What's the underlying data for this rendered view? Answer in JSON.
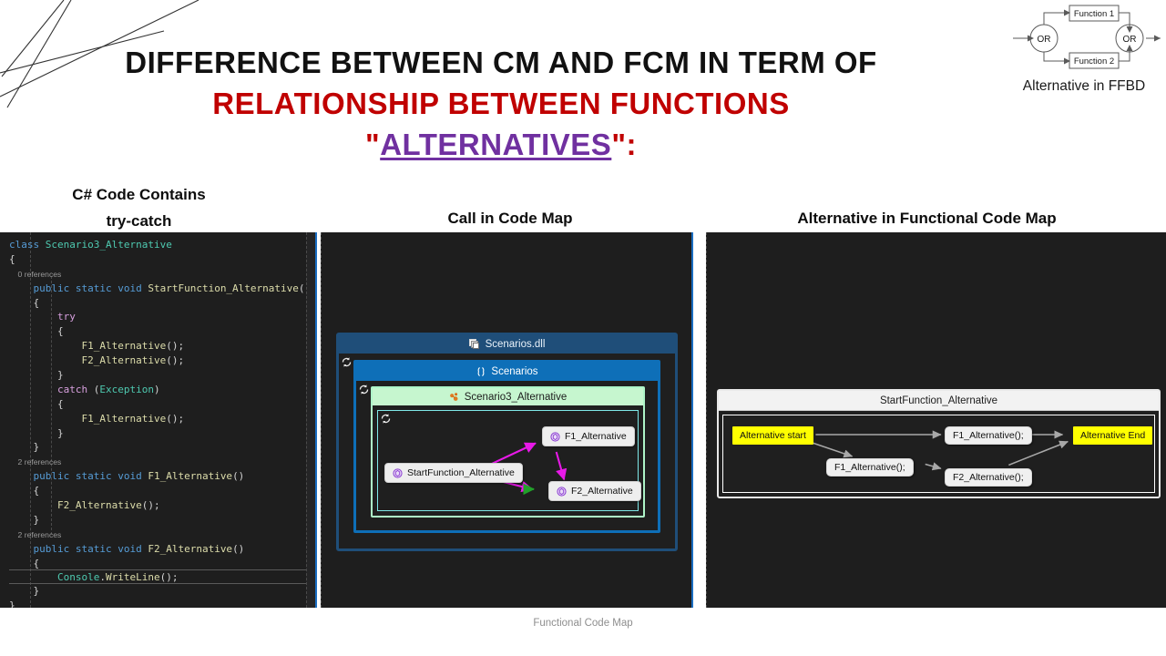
{
  "title": {
    "line1": "DIFFERENCE BETWEEN CM AND FCM IN TERM OF",
    "line2": "RELATIONSHIP BETWEEN FUNCTIONS",
    "line3_quote_open": "\"",
    "line3_alt": "ALTERNATIVES",
    "line3_quote_close": "\":",
    "color_line1": "#111111",
    "color_line2": "#C00000",
    "color_alt": "#7030A0"
  },
  "ffbd": {
    "caption": "Alternative in FFBD",
    "or_left": "OR",
    "or_right": "OR",
    "function1": "Function 1",
    "function2": "Function 2"
  },
  "columns": {
    "left_line1": "C# Code Contains",
    "left_line2": "try-catch",
    "middle": "Call in Code Map",
    "right": "Alternative in Functional Code Map"
  },
  "editor": {
    "lines": [
      {
        "id": "l1",
        "segments": [
          {
            "t": "class ",
            "c": "kw"
          },
          {
            "t": "Scenario3_Alternative",
            "c": "type"
          }
        ]
      },
      {
        "id": "l2",
        "segments": [
          {
            "t": "{",
            "c": "pun"
          }
        ]
      },
      {
        "id": "l3",
        "ref": "0 references",
        "indent": 2
      },
      {
        "id": "l4",
        "indent": 2,
        "segments": [
          {
            "t": "public ",
            "c": "kw"
          },
          {
            "t": "static ",
            "c": "kw"
          },
          {
            "t": "void ",
            "c": "kw"
          },
          {
            "t": "StartFunction_Alternative",
            "c": "fn"
          },
          {
            "t": "()",
            "c": "pun"
          }
        ]
      },
      {
        "id": "l5",
        "indent": 2,
        "segments": [
          {
            "t": "{",
            "c": "pun"
          }
        ]
      },
      {
        "id": "l6",
        "indent": 4,
        "segments": [
          {
            "t": "try",
            "c": "ctrl"
          }
        ]
      },
      {
        "id": "l7",
        "indent": 4,
        "segments": [
          {
            "t": "{",
            "c": "pun"
          }
        ]
      },
      {
        "id": "l8",
        "indent": 6,
        "segments": [
          {
            "t": "F1_Alternative",
            "c": "fn"
          },
          {
            "t": "();",
            "c": "pun"
          }
        ]
      },
      {
        "id": "l9",
        "indent": 6,
        "segments": [
          {
            "t": "F2_Alternative",
            "c": "fn"
          },
          {
            "t": "();",
            "c": "pun"
          }
        ]
      },
      {
        "id": "l10",
        "indent": 4,
        "segments": [
          {
            "t": "}",
            "c": "pun"
          }
        ]
      },
      {
        "id": "l11",
        "indent": 4,
        "segments": [
          {
            "t": "catch ",
            "c": "ctrl"
          },
          {
            "t": "(",
            "c": "pun"
          },
          {
            "t": "Exception",
            "c": "type"
          },
          {
            "t": ")",
            "c": "pun"
          }
        ]
      },
      {
        "id": "l12",
        "indent": 4,
        "segments": [
          {
            "t": "{",
            "c": "pun"
          }
        ]
      },
      {
        "id": "l13",
        "indent": 6,
        "segments": [
          {
            "t": "F1_Alternative",
            "c": "fn"
          },
          {
            "t": "();",
            "c": "pun"
          }
        ]
      },
      {
        "id": "l14",
        "indent": 4,
        "segments": [
          {
            "t": "}",
            "c": "pun"
          }
        ]
      },
      {
        "id": "l15",
        "indent": 2,
        "segments": [
          {
            "t": "}",
            "c": "pun"
          }
        ]
      },
      {
        "id": "l16",
        "ref": "2 references",
        "indent": 2
      },
      {
        "id": "l17",
        "indent": 2,
        "segments": [
          {
            "t": "public ",
            "c": "kw"
          },
          {
            "t": "static ",
            "c": "kw"
          },
          {
            "t": "void ",
            "c": "kw"
          },
          {
            "t": "F1_Alternative",
            "c": "fn"
          },
          {
            "t": "()",
            "c": "pun"
          }
        ]
      },
      {
        "id": "l18",
        "indent": 2,
        "segments": [
          {
            "t": "{",
            "c": "pun"
          }
        ]
      },
      {
        "id": "l19",
        "indent": 4,
        "segments": [
          {
            "t": "F2_Alternative",
            "c": "fn"
          },
          {
            "t": "();",
            "c": "pun"
          }
        ]
      },
      {
        "id": "l20",
        "indent": 2,
        "segments": [
          {
            "t": "}",
            "c": "pun"
          }
        ]
      },
      {
        "id": "l21",
        "ref": "2 references",
        "indent": 2
      },
      {
        "id": "l22",
        "indent": 2,
        "segments": [
          {
            "t": "public ",
            "c": "kw"
          },
          {
            "t": "static ",
            "c": "kw"
          },
          {
            "t": "void ",
            "c": "kw"
          },
          {
            "t": "F2_Alternative",
            "c": "fn"
          },
          {
            "t": "()",
            "c": "pun"
          }
        ]
      },
      {
        "id": "l23",
        "indent": 2,
        "segments": [
          {
            "t": "{",
            "c": "pun"
          }
        ]
      },
      {
        "id": "l24",
        "indent": 4,
        "highlight": true,
        "segments": [
          {
            "t": "Console",
            "c": "type"
          },
          {
            "t": ".",
            "c": "pun"
          },
          {
            "t": "WriteLine",
            "c": "fn"
          },
          {
            "t": "();",
            "c": "pun"
          }
        ]
      },
      {
        "id": "l25",
        "indent": 2,
        "segments": [
          {
            "t": "}",
            "c": "pun"
          }
        ]
      },
      {
        "id": "l26",
        "segments": [
          {
            "t": "}",
            "c": "pun"
          }
        ]
      }
    ]
  },
  "codemap": {
    "assembly": "Scenarios.dll",
    "namespace": "Scenarios",
    "class": "Scenario3_Alternative",
    "nodes": [
      {
        "id": "start",
        "label": "StartFunction_Alternative"
      },
      {
        "id": "f1",
        "label": "F1_Alternative"
      },
      {
        "id": "f2",
        "label": "F2_Alternative"
      }
    ],
    "edges": [
      {
        "from": "start",
        "to": "f1",
        "color": "#e819e8"
      },
      {
        "from": "start",
        "to": "f2",
        "color": "#e819e8"
      },
      {
        "from": "f1",
        "to": "f2",
        "color": "#e819e8"
      }
    ],
    "edge_color": "#e819e8"
  },
  "fcm": {
    "header": "StartFunction_Alternative",
    "nodes": [
      {
        "id": "alt_start",
        "label": "Alternative start",
        "kind": "yellow"
      },
      {
        "id": "f1_top",
        "label": "F1_Alternative();",
        "kind": "white"
      },
      {
        "id": "alt_end",
        "label": "Alternative End",
        "kind": "yellow"
      },
      {
        "id": "f1_bot",
        "label": "F1_Alternative();",
        "kind": "white"
      },
      {
        "id": "f2_bot",
        "label": "F2_Alternative();",
        "kind": "white"
      }
    ],
    "edges": [
      {
        "from": "alt_start",
        "to": "f1_top"
      },
      {
        "from": "alt_start",
        "to": "f1_bot"
      },
      {
        "from": "f1_top",
        "to": "alt_end"
      },
      {
        "from": "f1_bot",
        "to": "f2_bot"
      },
      {
        "from": "f2_bot",
        "to": "alt_end"
      }
    ],
    "edge_color": "#9a9a9a",
    "highlight_color": "#FFFF00"
  },
  "footer": {
    "text": "Functional Code Map"
  }
}
